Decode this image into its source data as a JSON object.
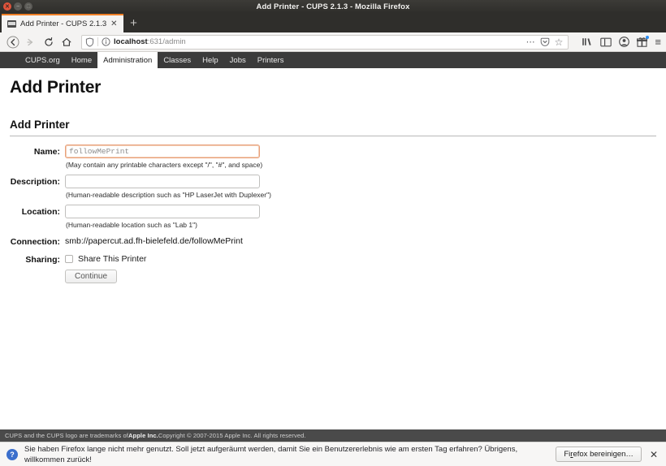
{
  "window": {
    "title": "Add Printer - CUPS 2.1.3 - Mozilla Firefox",
    "close_glyph": "✕",
    "minimize_glyph": "−",
    "maximize_glyph": "□"
  },
  "tabs": {
    "items": [
      {
        "label": "Add Printer - CUPS 2.1.3",
        "close_glyph": "✕"
      }
    ],
    "new_tab_glyph": "+"
  },
  "toolbar": {
    "back_glyph": "←",
    "forward_glyph": "→",
    "reload_glyph": "↻",
    "home_glyph": "⌂",
    "url_host": "localhost",
    "url_rest": ":631/admin",
    "shield_icon": "shield-icon",
    "info_icon": "info-icon",
    "ellipsis_glyph": "⋯",
    "pocket_icon": "pocket-icon",
    "star_glyph": "☆",
    "library_icon": "library-icon",
    "sidebar_icon": "sidebar-icon",
    "account_icon": "account-icon",
    "gift_icon": "gift-icon",
    "menu_glyph": "≡"
  },
  "cups_nav": {
    "items": [
      {
        "label": "CUPS.org",
        "active": false
      },
      {
        "label": "Home",
        "active": false
      },
      {
        "label": "Administration",
        "active": true
      },
      {
        "label": "Classes",
        "active": false
      },
      {
        "label": "Help",
        "active": false
      },
      {
        "label": "Jobs",
        "active": false
      },
      {
        "label": "Printers",
        "active": false
      }
    ]
  },
  "page": {
    "title": "Add Printer",
    "section_title": "Add Printer",
    "fields": {
      "name_label": "Name:",
      "name_value": "followMePrint",
      "name_hint": "(May contain any printable characters except \"/\", \"#\", and space)",
      "description_label": "Description:",
      "description_value": "",
      "description_hint": "(Human-readable description such as \"HP LaserJet with Duplexer\")",
      "location_label": "Location:",
      "location_value": "",
      "location_hint": "(Human-readable location such as \"Lab 1\")",
      "connection_label": "Connection:",
      "connection_value": "smb://papercut.ad.fh-bielefeld.de/followMePrint",
      "sharing_label": "Sharing:",
      "share_checkbox_label": "Share This Printer",
      "share_checked": false,
      "continue_label": "Continue"
    }
  },
  "footer": {
    "text_before": "CUPS and the CUPS logo are trademarks of ",
    "brand": "Apple Inc.",
    "text_after": " Copyright © 2007-2015 Apple Inc. All rights reserved."
  },
  "notification": {
    "icon_glyph": "?",
    "message": "Sie haben Firefox lange nicht mehr genutzt. Soll jetzt aufgeräumt werden, damit Sie ein Benutzererlebnis wie am ersten Tag erfahren? Übrigens, willkommen zurück!",
    "button_prefix": "Fi",
    "button_accel": "r",
    "button_suffix": "efox bereinigen…",
    "close_glyph": "✕"
  },
  "colors": {
    "accent_orange": "#ef7f26",
    "titlebar": "#2f2e2b",
    "cups_nav_bg": "#3b3b3b",
    "footer_bg": "#4a4a4a",
    "focus_border": "#e8a07a"
  }
}
